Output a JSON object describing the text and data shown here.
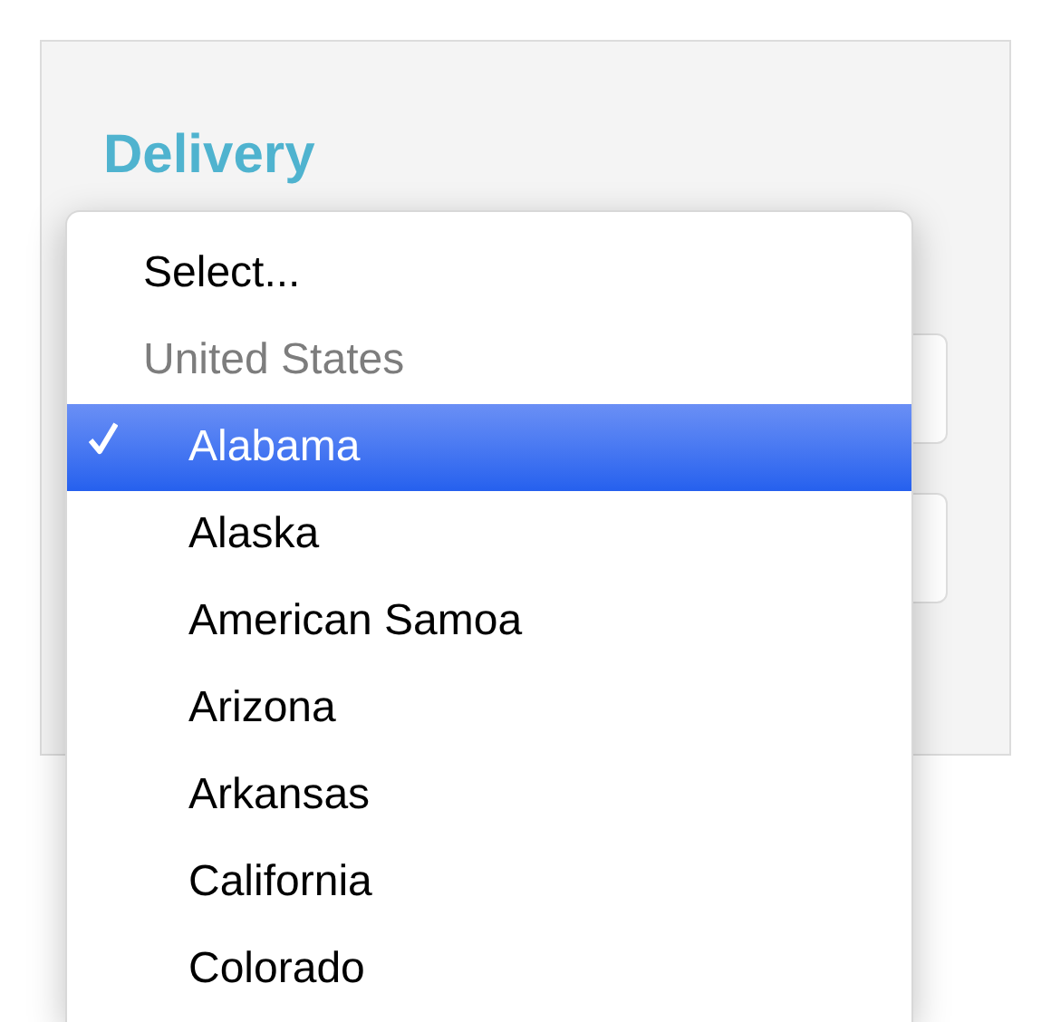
{
  "card": {
    "title": "Delivery"
  },
  "dropdown": {
    "items": [
      {
        "kind": "option",
        "label": "Select...",
        "selected": false
      },
      {
        "kind": "group",
        "label": "United States"
      },
      {
        "kind": "suboption",
        "label": "Alabama",
        "selected": true
      },
      {
        "kind": "suboption",
        "label": "Alaska",
        "selected": false
      },
      {
        "kind": "suboption",
        "label": "American Samoa",
        "selected": false
      },
      {
        "kind": "suboption",
        "label": "Arizona",
        "selected": false
      },
      {
        "kind": "suboption",
        "label": "Arkansas",
        "selected": false
      },
      {
        "kind": "suboption",
        "label": "California",
        "selected": false
      },
      {
        "kind": "suboption",
        "label": "Colorado",
        "selected": false
      }
    ]
  }
}
